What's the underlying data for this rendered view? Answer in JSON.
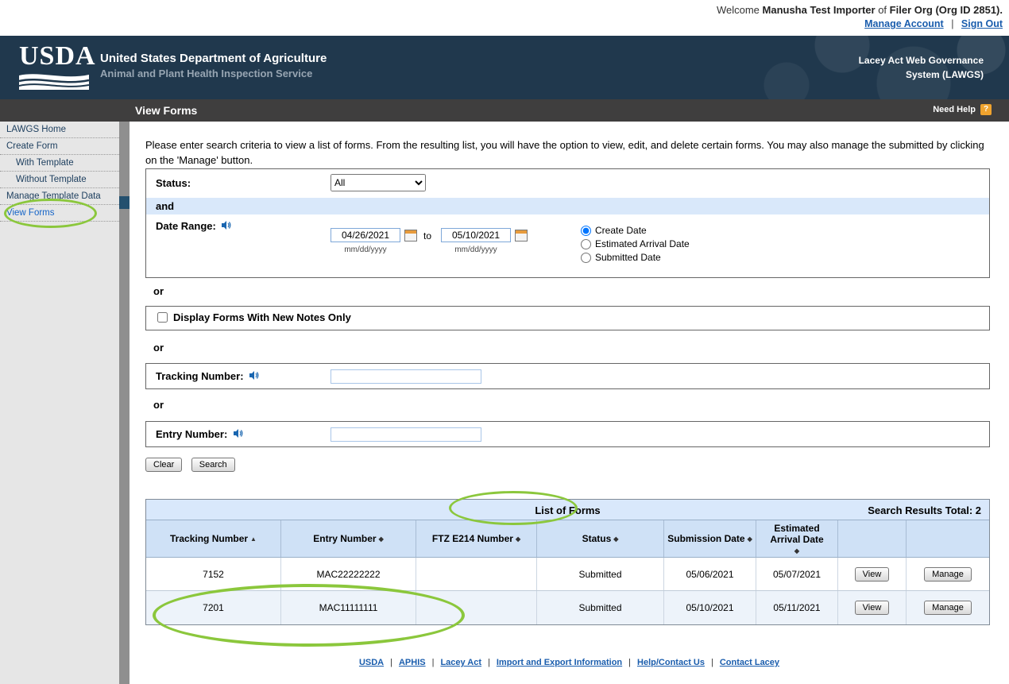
{
  "welcome": {
    "text_prefix": "Welcome",
    "user_name": "Manusha Test Importer",
    "text_of": "of",
    "org_name": "Filer Org (Org ID 2851).",
    "manage_account_link": "Manage Account",
    "separator": "|",
    "sign_out_link": "Sign Out"
  },
  "header": {
    "logo": "USDA",
    "department": "United States Department of Agriculture",
    "agency": "Animal and Plant Health Inspection Service",
    "system_line1": "Lacey Act Web Governance",
    "system_line2": "System (LAWGS)"
  },
  "title_bar": {
    "title": "View Forms",
    "need_help": "Need Help",
    "help_symbol": "?"
  },
  "sidebar": {
    "items": [
      {
        "label": "LAWGS Home"
      },
      {
        "label": "Create Form"
      },
      {
        "label": "With Template"
      },
      {
        "label": "Without Template"
      },
      {
        "label": "Manage Template Data"
      },
      {
        "label": "View Forms"
      }
    ]
  },
  "main": {
    "instructions": "Please enter search criteria to view a list of forms. From the resulting list, you will have the option to view, edit, and delete certain forms. You may also manage the submitted by clicking on the 'Manage' button.",
    "search": {
      "status_label": "Status:",
      "status_value": "All",
      "and_label": "and",
      "date_range_label": "Date Range:",
      "date_from": "04/26/2021",
      "date_to_label": "to",
      "date_to": "05/10/2021",
      "date_hint": "mm/dd/yyyy",
      "radios": [
        {
          "label": "Create Date",
          "checked": "checked"
        },
        {
          "label": "Estimated Arrival Date"
        },
        {
          "label": "Submitted Date"
        }
      ],
      "or_label": "or",
      "notes_checkbox_label": "Display Forms With New Notes Only",
      "tracking_label": "Tracking Number:",
      "entry_label": "Entry Number:",
      "clear_button": "Clear",
      "search_button": "Search"
    },
    "results": {
      "caption": "List of Forms",
      "total": "Search Results Total: 2",
      "columns": [
        {
          "label": "Tracking Number",
          "sort": "▲"
        },
        {
          "label": "Entry Number",
          "sort": "◆"
        },
        {
          "label": "FTZ E214 Number",
          "sort": "◆"
        },
        {
          "label": "Status",
          "sort": "◆"
        },
        {
          "label": "Submission Date",
          "sort": "◆"
        },
        {
          "label": "Estimated Arrival Date",
          "sort": "◆"
        },
        {
          "label": ""
        },
        {
          "label": ""
        }
      ],
      "rows": [
        {
          "tracking_number": "7152",
          "entry_number": "MAC22222222",
          "ftz_e214_number": "",
          "status": "Submitted",
          "submission_date": "05/06/2021",
          "estimated_arrival_date": "05/07/2021"
        },
        {
          "tracking_number": "7201",
          "entry_number": "MAC11111111",
          "ftz_e214_number": "",
          "status": "Submitted",
          "submission_date": "05/10/2021",
          "estimated_arrival_date": "05/11/2021"
        }
      ],
      "view_label": "View",
      "manage_label": "Manage"
    }
  },
  "footer": {
    "links": [
      "USDA",
      "APHIS",
      "Lacey Act",
      "Import and Export Information",
      "Help/Contact Us",
      "Contact Lacey"
    ],
    "separator": "|"
  }
}
